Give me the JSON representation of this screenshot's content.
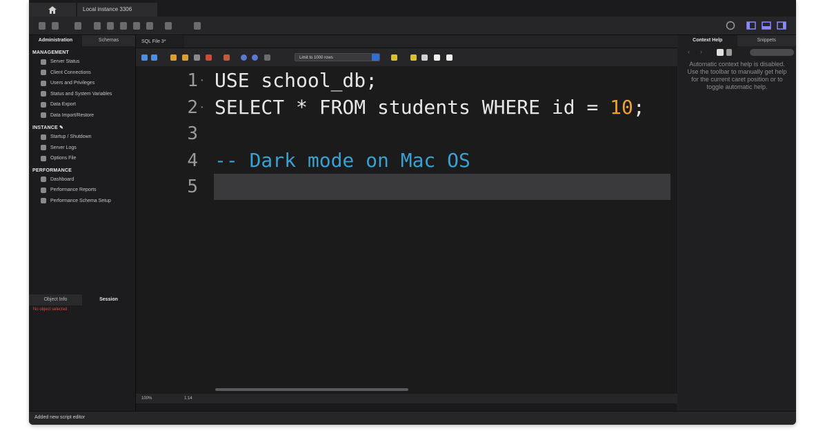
{
  "window": {
    "home_icon": "home-icon",
    "instance_tab": "Local instance 3306"
  },
  "sidebar": {
    "tabs": [
      "Administration",
      "Schemas"
    ],
    "sections": [
      {
        "title": "MANAGEMENT",
        "items": [
          "Server Status",
          "Client Connections",
          "Users and Privileges",
          "Status and System Variables",
          "Data Export",
          "Data Import/Restore"
        ]
      },
      {
        "title": "INSTANCE ✎",
        "items": [
          "Startup / Shutdown",
          "Server Logs",
          "Options File"
        ]
      },
      {
        "title": "PERFORMANCE",
        "items": [
          "Dashboard",
          "Performance Reports",
          "Performance Schema Setup"
        ]
      }
    ],
    "bottom_tabs": [
      "Object Info",
      "Session"
    ],
    "error": "No object selected"
  },
  "editor": {
    "tab": "SQL File 3*",
    "limit": "Limit to 1000 rows",
    "lines": [
      {
        "num": "1",
        "dot": "·",
        "tokens": [
          {
            "t": "USE school_db;",
            "c": "kw"
          }
        ]
      },
      {
        "num": "2",
        "dot": "·",
        "tokens": [
          {
            "t": "SELECT * FROM students WHERE id = ",
            "c": "kw"
          },
          {
            "t": "10",
            "c": "num"
          },
          {
            "t": ";",
            "c": "kw"
          }
        ]
      },
      {
        "num": "3",
        "dot": "",
        "tokens": []
      },
      {
        "num": "4",
        "dot": "",
        "tokens": [
          {
            "t": "-- Dark mode on Mac OS",
            "c": "comment"
          }
        ]
      },
      {
        "num": "5",
        "dot": "",
        "tokens": []
      }
    ],
    "current_line": 5,
    "status": {
      "zoom": "100%",
      "pos": "1:14"
    }
  },
  "right_panel": {
    "tabs": [
      "Context Help",
      "Snippets"
    ],
    "text": "Automatic context help is disabled. Use the toolbar to manually get help for the current caret position or to toggle automatic help."
  },
  "statusbar": {
    "text": "Added new script editor"
  },
  "colors": {
    "keyword": "#e6e6e6",
    "number": "#f0a030",
    "comment": "#3aa0d0",
    "current_line": "#3a3a3c"
  }
}
